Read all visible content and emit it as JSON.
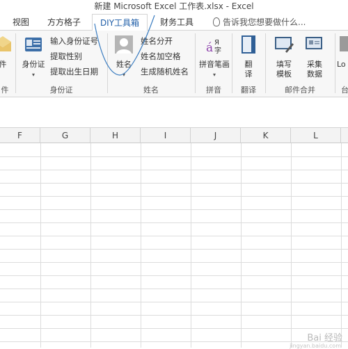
{
  "window": {
    "title": "新建 Microsoft Excel 工作表.xlsx - Excel"
  },
  "tabs": [
    {
      "label": "视图"
    },
    {
      "label": "方方格子"
    },
    {
      "label": "DIY工具箱"
    },
    {
      "label": "财务工具"
    }
  ],
  "tellme": {
    "label": "告诉我您想要做什么..."
  },
  "ribbon": {
    "groups": {
      "mail_partial": {
        "btn_label": "件",
        "group_label": "件"
      },
      "id_card": {
        "group_label": "身份证",
        "big_button": {
          "label": "身份证"
        },
        "items": [
          "输入身份证号",
          "提取性别",
          "提取出生日期"
        ]
      },
      "name": {
        "group_label": "姓名",
        "big_button": {
          "label": "姓名"
        },
        "items": [
          "姓名分开",
          "姓名加空格",
          "生成随机姓名"
        ]
      },
      "pinyin": {
        "group_label": "拼音",
        "big_button": {
          "label": "拼音笔画"
        }
      },
      "translate": {
        "group_label": "翻译",
        "big_button": {
          "label": "翻译"
        }
      },
      "mail_merge": {
        "group_label": "邮件合并",
        "buttons": [
          {
            "label": "填写模板"
          },
          {
            "label": "采集数据"
          }
        ]
      },
      "right_partial": {
        "btn_label": "Lo",
        "group_label": "台"
      }
    }
  },
  "grid": {
    "columns": [
      "F",
      "G",
      "H",
      "I",
      "J",
      "K",
      "L"
    ]
  },
  "watermark": {
    "text": "Bai 经验",
    "sub": "jingyan.baidu.com"
  },
  "colors": {
    "accent": "#1f5ea8",
    "ribbon_bg": "#f7f7f7",
    "grid_line": "#dcdcdc"
  }
}
